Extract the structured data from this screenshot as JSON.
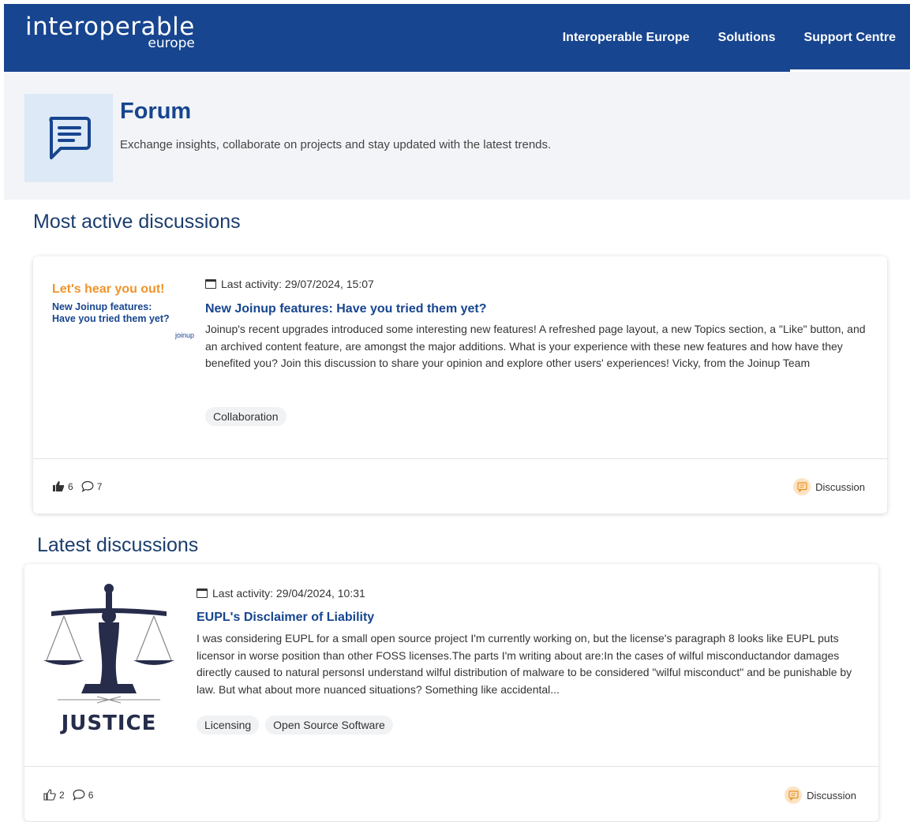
{
  "header": {
    "logo_line1": "interoperable",
    "logo_line2": "europe",
    "nav": [
      {
        "label": "Interoperable Europe"
      },
      {
        "label": "Solutions"
      },
      {
        "label": "Support Centre"
      }
    ]
  },
  "hero": {
    "title": "Forum",
    "subtitle": "Exchange insights, collaborate on projects and stay updated with the latest trends."
  },
  "sections": {
    "most_active": "Most active discussions",
    "latest": "Latest discussions"
  },
  "cards": [
    {
      "thumb": {
        "line1": "Let's hear you out!",
        "line2a": "New Joinup features:",
        "line2b": "Have you tried them yet?",
        "line3": "joinup"
      },
      "last_activity": "Last activity: 29/07/2024, 15:07",
      "title": "New Joinup features: Have you tried them yet?",
      "body": "Joinup's recent upgrades introduced some interesting new features! A refreshed page layout, a new Topics section, a \"Like\" button, and an archived content feature, are amongst the major additions. What is your experience with these new features and how have they benefited you? Join this discussion to share your opinion and explore other users' experiences! Vicky, from the Joinup Team",
      "tags": [
        "Collaboration"
      ],
      "likes": "6",
      "comments": "7",
      "type": "Discussion"
    },
    {
      "thumb": {
        "word": "JUSTICE"
      },
      "last_activity": "Last activity: 29/04/2024, 10:31",
      "title": "EUPL's Disclaimer of Liability",
      "body": "I was considering EUPL for a small open source project I'm currently working on, but the license's paragraph 8 looks like EUPL puts licensor in worse position than other FOSS licenses.The parts I'm writing about are:In the cases of wilful misconductandor damages directly caused to natural personsI understand wilful distribution of malware to be considered \"wilful misconduct\" and be punishable by law. But what about more nuanced situations? Something like accidental...",
      "tags": [
        "Licensing",
        "Open Source Software"
      ],
      "likes": "2",
      "comments": "6",
      "type": "Discussion"
    }
  ],
  "colors": {
    "brand": "#17458f",
    "hero_bg": "#f2f4f7",
    "icon_bg": "#dde9f7",
    "accent_orange": "#f0942b",
    "badge_bg": "#fbe3c4"
  }
}
